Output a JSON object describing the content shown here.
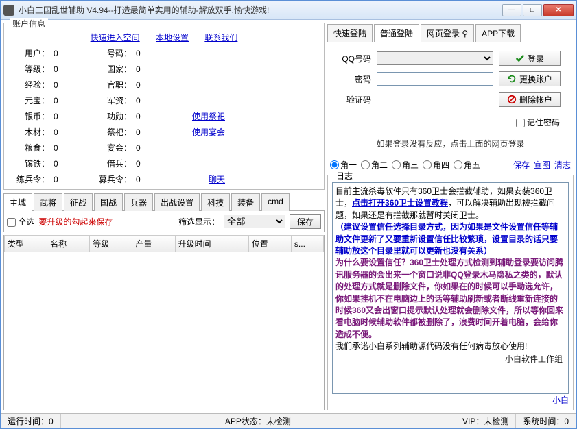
{
  "window": {
    "title": "小白三国乱世辅助 V4.94--打造最简单实用的辅助-解放双手,愉快游戏!"
  },
  "account_box": {
    "legend": "账户信息",
    "links": {
      "quick_enter": "快速进入空间",
      "local_settings": "本地设置",
      "contact": "联系我们"
    },
    "rows": [
      {
        "l1": "用户：",
        "v1": "0",
        "l2": "号码：",
        "v2": "0",
        "side": ""
      },
      {
        "l1": "等级：",
        "v1": "0",
        "l2": "国家：",
        "v2": "0",
        "side": ""
      },
      {
        "l1": "经验：",
        "v1": "0",
        "l2": "官职：",
        "v2": "0",
        "side": ""
      },
      {
        "l1": "元宝：",
        "v1": "0",
        "l2": "军资：",
        "v2": "0",
        "side": ""
      },
      {
        "l1": "银币：",
        "v1": "0",
        "l2": "功勋：",
        "v2": "0",
        "side": "使用祭祀"
      },
      {
        "l1": "木材：",
        "v1": "0",
        "l2": "祭祀：",
        "v2": "0",
        "side": "使用宴会"
      },
      {
        "l1": "粮食：",
        "v1": "0",
        "l2": "宴会：",
        "v2": "0",
        "side": ""
      },
      {
        "l1": "镔铁：",
        "v1": "0",
        "l2": "借兵：",
        "v2": "0",
        "side": ""
      },
      {
        "l1": "练兵令：",
        "v1": "0",
        "l2": "募兵令：",
        "v2": "0",
        "side": "聊天"
      }
    ]
  },
  "lower_tabs": [
    "主城",
    "武将",
    "征战",
    "国战",
    "兵器",
    "出战设置",
    "科技",
    "装备",
    "cmd"
  ],
  "filter": {
    "select_all": "全选",
    "tip": "要升级的勾起来保存",
    "filter_label": "筛选显示：",
    "filter_value": "全部",
    "save_btn": "保存"
  },
  "columns": [
    "类型",
    "名称",
    "等级",
    "产量",
    "升级时间",
    "位置",
    "s..."
  ],
  "login_tabs": [
    "快速登陆",
    "普通登陆",
    "网页登录 ⚲",
    "APP下载"
  ],
  "login_form": {
    "qq_label": "QQ号码",
    "pwd_label": "密码",
    "captcha_label": "验证码",
    "login_btn": "登录",
    "switch_btn": "更换账户",
    "delete_btn": "删除帐户",
    "remember": "记住密码"
  },
  "notice": "如果登录没有反应，点击上面的网页登录",
  "slots": {
    "labels": [
      "角一",
      "角二",
      "角三",
      "角四",
      "角五"
    ],
    "links": [
      "保存",
      "宣图",
      "清志"
    ]
  },
  "log": {
    "legend": "日志",
    "p1a": "目前主流杀毒软件只有360卫士会拦截辅助，如果安装360卫士，",
    "p1link": "点击打开360卫士设置教程",
    "p1b": "，可以解决辅助出现被拦截问题，如果还是有拦截那就暂时关闭卫士。",
    "p2": "（建议设置信任选择目录方式，因为如果是文件设置信任等辅助文件更新了又要重新设置信任比较繁琐，设置目录的话只要辅助放这个目录里就可以更新也没有关系）",
    "p3": "为什么要设置信任？360卫士处理方式检测到辅助登录要访问腾讯服务器的会出来一个窗口说非QQ登录木马隐私之类的，默认的处理方式就是删除文件，你如果在的时候可以手动选允许，你如果挂机不在电脑边上的话等辅助刷新或者断线重新连接的时候360又会出窗口提示默认处理就会删除文件，所以等你回来看电脑时候辅助软件都被删除了，浪费时间开着电脑，会给你造成不便。",
    "p4": "我们承诺小白系列辅助源代码没有任何病毒放心使用!",
    "sig": "小白软件工作组",
    "bottom_link": "小白"
  },
  "status": {
    "runtime": "运行时间：0",
    "app_state": "APP状态：未检测",
    "vip": "VIP：未检测",
    "systime": "系统时间：0"
  }
}
